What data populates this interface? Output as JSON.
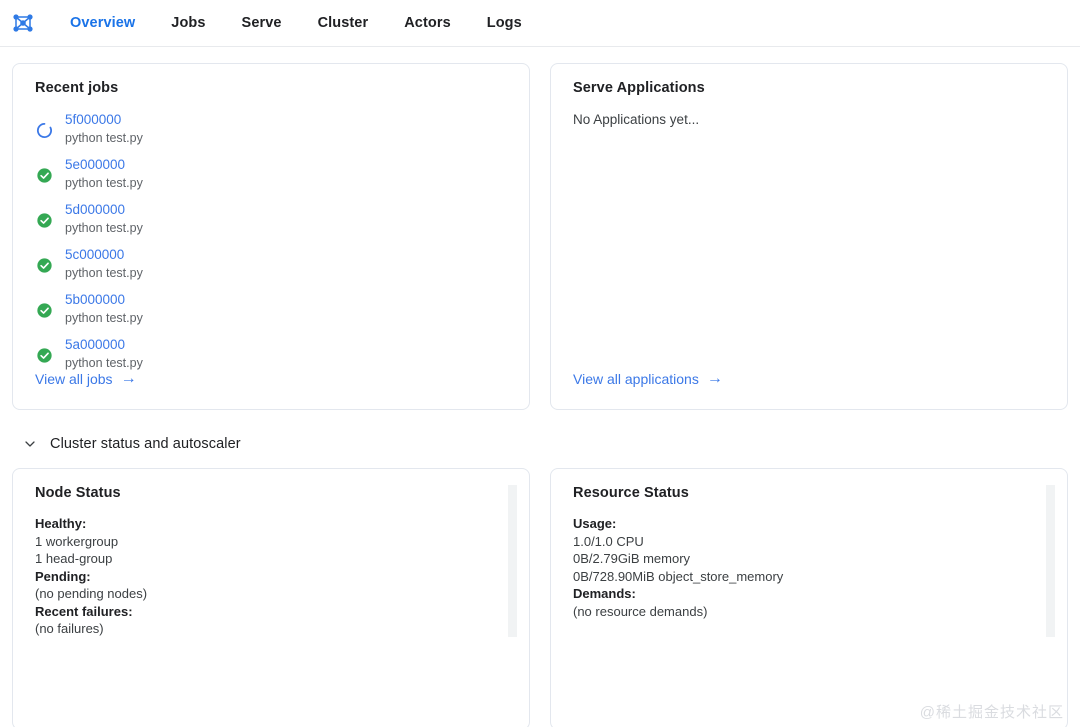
{
  "nav": {
    "logo_icon": "ray-logo-icon",
    "tabs": [
      {
        "label": "Overview",
        "active": true
      },
      {
        "label": "Jobs",
        "active": false
      },
      {
        "label": "Serve",
        "active": false
      },
      {
        "label": "Cluster",
        "active": false
      },
      {
        "label": "Actors",
        "active": false
      },
      {
        "label": "Logs",
        "active": false
      }
    ]
  },
  "recent_jobs": {
    "title": "Recent jobs",
    "jobs": [
      {
        "id": "5f000000",
        "command": "python test.py",
        "status": "running",
        "status_icon": "spinner-icon"
      },
      {
        "id": "5e000000",
        "command": "python test.py",
        "status": "succeeded",
        "status_icon": "check-circle-icon"
      },
      {
        "id": "5d000000",
        "command": "python test.py",
        "status": "succeeded",
        "status_icon": "check-circle-icon"
      },
      {
        "id": "5c000000",
        "command": "python test.py",
        "status": "succeeded",
        "status_icon": "check-circle-icon"
      },
      {
        "id": "5b000000",
        "command": "python test.py",
        "status": "succeeded",
        "status_icon": "check-circle-icon"
      },
      {
        "id": "5a000000",
        "command": "python test.py",
        "status": "succeeded",
        "status_icon": "check-circle-icon"
      }
    ],
    "view_all_label": "View all jobs",
    "view_all_arrow": "→"
  },
  "serve_applications": {
    "title": "Serve Applications",
    "empty_message": "No Applications yet...",
    "view_all_label": "View all applications",
    "view_all_arrow": "→"
  },
  "cluster_section": {
    "title": "Cluster status and autoscaler",
    "chevron_icon": "chevron-down-icon",
    "expanded": true
  },
  "node_status": {
    "title": "Node Status",
    "groups": [
      {
        "label": "Healthy:",
        "values": [
          "1 workergroup",
          "1 head-group"
        ]
      },
      {
        "label": "Pending:",
        "values": [
          "(no pending nodes)"
        ]
      },
      {
        "label": "Recent failures:",
        "values": [
          "(no failures)"
        ]
      }
    ]
  },
  "resource_status": {
    "title": "Resource Status",
    "groups": [
      {
        "label": "Usage:",
        "values": [
          "1.0/1.0 CPU",
          "0B/2.79GiB memory",
          "0B/728.90MiB object_store_memory"
        ]
      },
      {
        "label": "Demands:",
        "values": [
          "(no resource demands)"
        ]
      }
    ]
  },
  "watermark": {
    "text": "@稀土掘金技术社区"
  },
  "colors": {
    "accent_blue": "#1a73e8",
    "link_blue": "#3b78e7",
    "success_green": "#34a853",
    "text_primary": "#202124",
    "text_secondary": "#5f6368",
    "card_border": "#e3e7ee"
  }
}
